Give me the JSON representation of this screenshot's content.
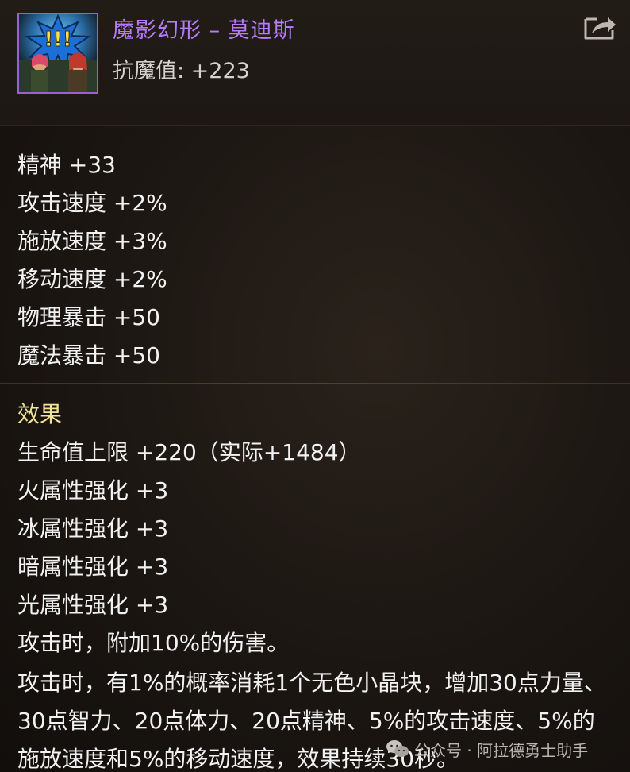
{
  "item": {
    "name": "魔影幻形 – 莫迪斯",
    "magic_resist": "抗魔值: +223",
    "name_color": "#b77bff",
    "icon": "character-art-icon",
    "share_icon": "share-icon"
  },
  "stats": [
    "精神 +33",
    "攻击速度 +2%",
    "施放速度 +3%",
    "移动速度 +2%",
    "物理暴击 +50",
    "魔法暴击 +50"
  ],
  "effect": {
    "title": "效果",
    "title_color": "#f2e39a",
    "lines": [
      "生命值上限 +220（实际+1484）",
      "火属性强化 +3",
      "冰属性强化 +3",
      "暗属性强化 +3",
      "光属性强化 +3",
      "攻击时，附加10%的伤害。"
    ],
    "description": "攻击时，有1%的概率消耗1个无色小晶块，增加30点力量、30点智力、20点体力、20点精神、5%的攻击速度、5%的施放速度和5%的移动速度，效果持续30秒。"
  },
  "watermark": {
    "text": "公众号 · 阿拉德勇士助手",
    "icon": "wechat-icon"
  }
}
